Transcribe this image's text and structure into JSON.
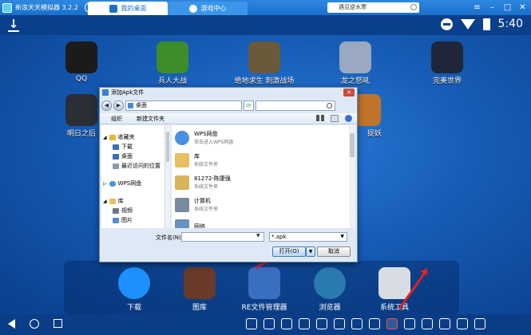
{
  "titlebar": {
    "app_title": "新浪天天模拟器 3.2.2",
    "tabs": [
      {
        "label": "我的桌面",
        "active": true
      },
      {
        "label": "游戏中心",
        "active": false
      }
    ],
    "search_text": "遇见逆水寒"
  },
  "statusbar": {
    "time": "5:40"
  },
  "desktop": {
    "apps": [
      {
        "label": "QQ",
        "color": "#1b1b1b"
      },
      {
        "label": "兵人大战",
        "color": "#3e8c2a"
      },
      {
        "label": "绝地求生 刺激战场",
        "color": "#6a5a3a"
      },
      {
        "label": "龙之怒吼",
        "color": "#9aa8c0"
      },
      {
        "label": "完美世界",
        "color": "#20263a"
      },
      {
        "label": "明日之后",
        "color": "#2a2f36"
      },
      {
        "label": "捉妖",
        "color": "#c0742a"
      }
    ],
    "dock": [
      {
        "label": "下载",
        "color": "#1e90ff"
      },
      {
        "label": "图库",
        "color": "#6a3a2a"
      },
      {
        "label": "RE文件管理器",
        "color": "#3a6fc0"
      },
      {
        "label": "浏览器",
        "color": "#2a7ab0"
      },
      {
        "label": "系统工具",
        "color": "#d8dde5"
      }
    ]
  },
  "dialog": {
    "title": "添加Apk文件",
    "address": "桌面",
    "toolbar": {
      "organize": "组织",
      "new_folder": "新建文件夹"
    },
    "nav": [
      {
        "label": "收藏夹",
        "color": "#e8b830"
      },
      {
        "label": "下载",
        "color": "#3a6fc0"
      },
      {
        "label": "桌面",
        "color": "#3a6fc0"
      },
      {
        "label": "最近访问的位置",
        "color": "#8a9ab0"
      },
      {
        "label": "WPS网盘",
        "color": "#4a90e2"
      },
      {
        "label": "库",
        "color": "#e8c060"
      },
      {
        "label": "视频",
        "color": "#6a7a8a"
      },
      {
        "label": "图片",
        "color": "#5a8ad0"
      }
    ],
    "files": [
      {
        "name": "WPS网盘",
        "desc": "双击进入WPS网盘",
        "color": "#4a90e2"
      },
      {
        "name": "库",
        "desc": "系统文件夹",
        "color": "#e8c060"
      },
      {
        "name": "81272-陈康强",
        "desc": "系统文件夹",
        "color": "#d9b45a"
      },
      {
        "name": "计算机",
        "desc": "系统文件夹",
        "color": "#7a8aa0"
      },
      {
        "name": "网络",
        "desc": "",
        "color": "#6a90c0"
      }
    ],
    "filename_label": "文件名(N):",
    "filename_value": "",
    "filetype": "*.apk",
    "open_button": "打开(O)",
    "cancel_button": "取消"
  }
}
